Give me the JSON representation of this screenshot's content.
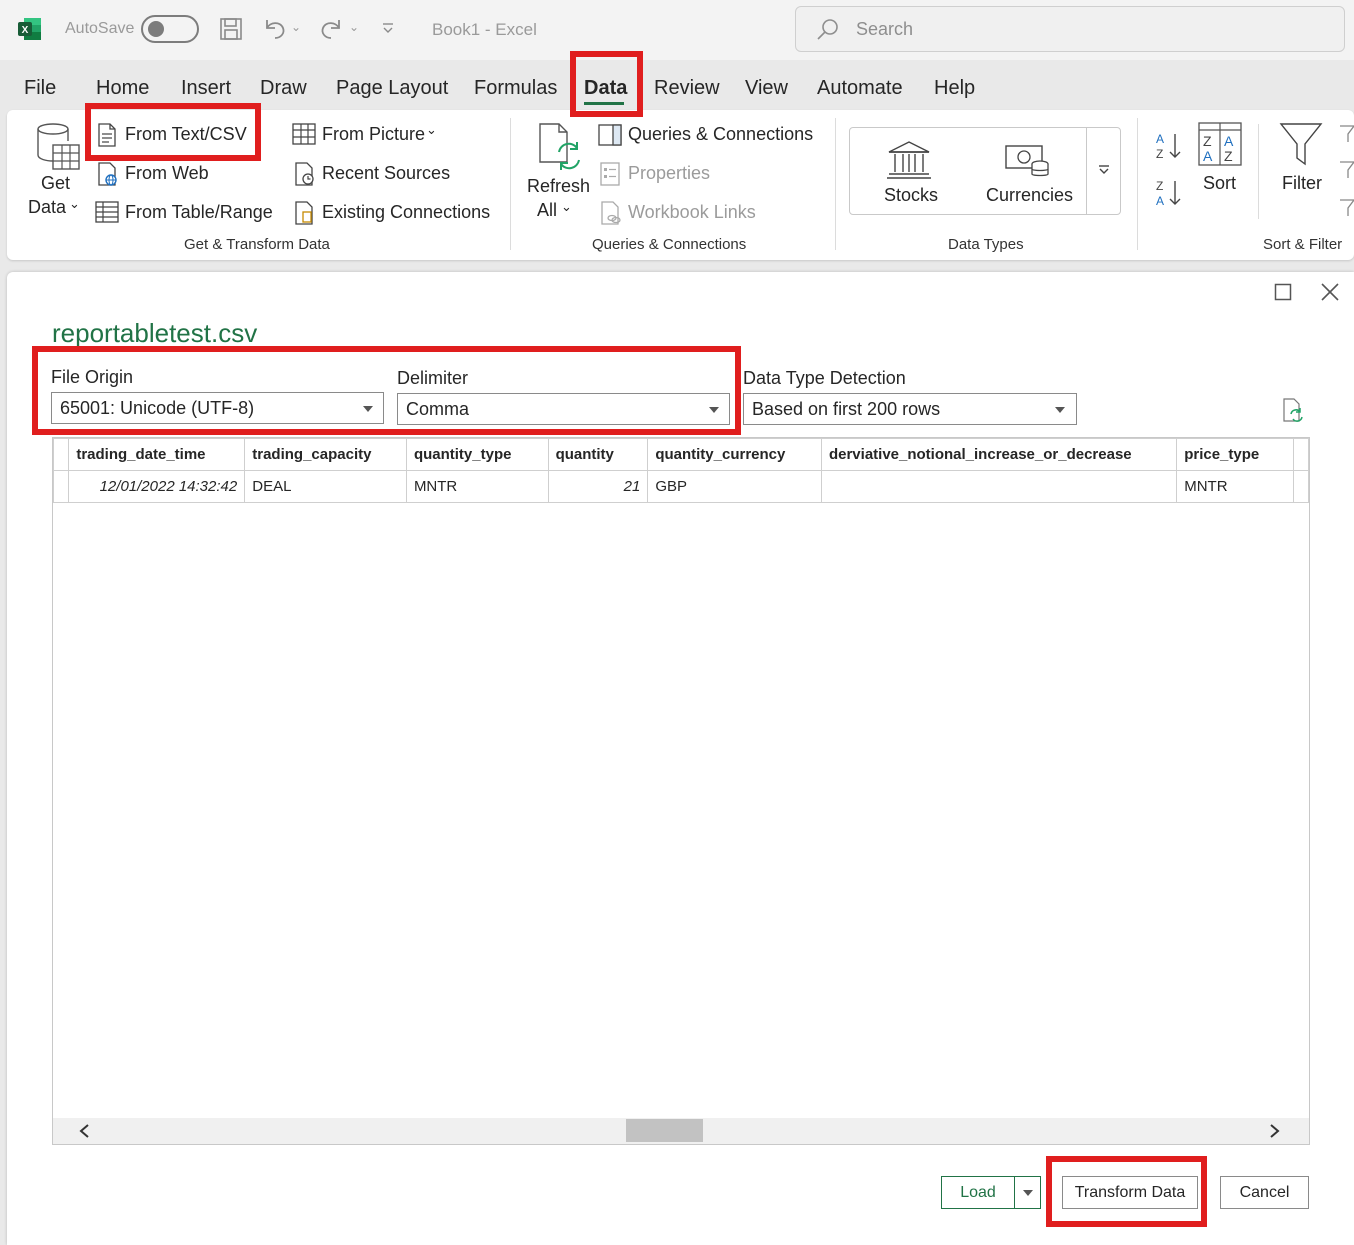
{
  "app": {
    "autosave_label": "AutoSave",
    "document_title": "Book1  -  Excel",
    "search_placeholder": "Search"
  },
  "tabs": [
    {
      "label": "File"
    },
    {
      "label": "Home"
    },
    {
      "label": "Insert"
    },
    {
      "label": "Draw"
    },
    {
      "label": "Page Layout"
    },
    {
      "label": "Formulas"
    },
    {
      "label": "Data",
      "active": true
    },
    {
      "label": "Review"
    },
    {
      "label": "View"
    },
    {
      "label": "Automate"
    },
    {
      "label": "Help"
    }
  ],
  "ribbon": {
    "get_transform": {
      "get_data_line1": "Get",
      "get_data_line2": "Data",
      "from_text_csv": "From Text/CSV",
      "from_web": "From Web",
      "from_table_range": "From Table/Range",
      "from_picture": "From Picture",
      "recent_sources": "Recent Sources",
      "existing_connections": "Existing Connections",
      "group_label": "Get & Transform Data"
    },
    "queries": {
      "refresh_line1": "Refresh",
      "refresh_line2": "All",
      "queries_connections": "Queries & Connections",
      "properties": "Properties",
      "workbook_links": "Workbook Links",
      "group_label": "Queries & Connections"
    },
    "data_types": {
      "stocks": "Stocks",
      "currencies": "Currencies",
      "group_label": "Data Types"
    },
    "sort_filter": {
      "sort": "Sort",
      "filter": "Filter",
      "group_label": "Sort & Filter"
    }
  },
  "dialog": {
    "file_name": "reportabletest.csv",
    "file_origin": {
      "label": "File Origin",
      "value": "65001: Unicode (UTF-8)"
    },
    "delimiter": {
      "label": "Delimiter",
      "value": "Comma"
    },
    "type_detection": {
      "label": "Data Type Detection",
      "value": "Based on first 200 rows"
    },
    "columns": [
      "trading_date_time",
      "trading_capacity",
      "quantity_type",
      "quantity",
      "quantity_currency",
      "derviative_notional_increase_or_decrease",
      "price_type"
    ],
    "rows": [
      [
        "12/01/2022 14:32:42",
        "DEAL",
        "MNTR",
        "21",
        "GBP",
        "",
        "MNTR"
      ]
    ],
    "buttons": {
      "load": "Load",
      "transform": "Transform Data",
      "cancel": "Cancel"
    }
  },
  "colors": {
    "excel_green": "#217346",
    "highlight_red": "#e01e1e"
  },
  "icons": [
    "excel-logo-icon",
    "save-icon",
    "undo-icon",
    "redo-icon",
    "customize-qat-icon",
    "search-icon",
    "maximize-icon",
    "close-icon",
    "refresh-preview-icon",
    "scroll-left-icon",
    "scroll-right-icon"
  ]
}
